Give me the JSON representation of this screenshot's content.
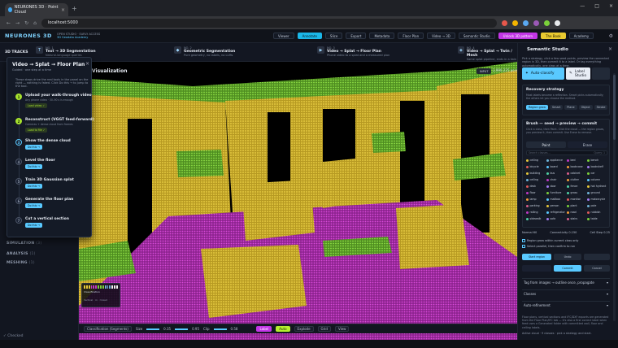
{
  "browser": {
    "tab_title": "NEURONES 3D · Point Cloud",
    "tab_close": "×",
    "new_tab": "+",
    "url": "localhost:5000",
    "window_controls": [
      "—",
      "□",
      "×"
    ],
    "nav": [
      "←",
      "→",
      "↻",
      "⌂"
    ]
  },
  "app": {
    "brand": "NEURONES 3D",
    "subtitle": [
      "OPEN STUDIO · EARLY ACCESS",
      "3D Geodata Academy"
    ],
    "toolbar": [
      {
        "label": "Viewer",
        "style": "plain"
      },
      {
        "label": "Annotate",
        "style": "active"
      },
      {
        "label": "Slice",
        "style": "plain"
      },
      {
        "label": "Export",
        "style": "plain"
      },
      {
        "label": "Metadata",
        "style": "plain"
      },
      {
        "label": "Floor Plan",
        "style": "plain"
      },
      {
        "label": "Video → 3D",
        "style": "plain"
      },
      {
        "label": "Semantic Studio",
        "style": "plain"
      },
      {
        "label": "Unlock 3D pattern",
        "style": "magenta"
      },
      {
        "label": "The Book",
        "style": "yellow"
      },
      {
        "label": "Academy",
        "style": "plain"
      }
    ]
  },
  "tracks": {
    "label": "3D TRACKS",
    "items": [
      {
        "tag": "NO. 1",
        "title": "Text → 3D Segmentation",
        "desc": "Natural-language queries"
      },
      {
        "tag": "NO. 2",
        "title": "Geometric Segmentation",
        "desc": "Pure geometry, no labels, no LLMs"
      },
      {
        "tag": "NO. 3",
        "title": "Video → Splat → Floor Plan",
        "desc": "Phone video to a splat and a measured plan"
      },
      {
        "tag": "NO. 4",
        "title": "Video → Splat → Twin / Mesh",
        "desc": "Same splat pipeline, ends in a twin"
      }
    ]
  },
  "sidebar": {
    "sections": [
      {
        "label": "SIMULATION",
        "count": "(3)"
      },
      {
        "label": "ANALYSIS",
        "count": "(1)"
      },
      {
        "label": "MESHING",
        "count": "(1)"
      }
    ],
    "footer": "✓ Checked"
  },
  "viewport": {
    "title": "Visualization",
    "input_chip": "INPUT",
    "point_count": "2,990,225 points",
    "legend_title": "Classification",
    "legend_sub": "Vertical · in · mixed",
    "colors": [
      "#e7c83a",
      "#c238c6",
      "#7bd23a",
      "#6fb4d8",
      "#f2f2f2"
    ]
  },
  "bottombar": {
    "mode": "Classification (Segments)",
    "size_label": "Size",
    "size_val": "0.35",
    "opacity_val": "0.95",
    "clip_label": "Clip",
    "clip_val": "0.58",
    "buttons": [
      "Label",
      "Auto",
      "Explode",
      "Grid",
      "View"
    ]
  },
  "popup": {
    "title": "Video → Splat → Floor Plan",
    "subtitle": "Guided · one step at a time",
    "intro": "These steps drive the real tools in the panel on the right — nothing is faked. Click Do this → to jump to the tool.",
    "steps": [
      {
        "n": "1",
        "state": "done",
        "title": "Upload your walk-through video",
        "desc": "Any phone video · 30–90 s is enough",
        "btn": "Load video ✓"
      },
      {
        "n": "2",
        "state": "done",
        "title": "Reconstruct (VGGT feed-forward)",
        "desc": "Cameras + dense cloud from frames",
        "btn": "Load to file ✓"
      },
      {
        "n": "3",
        "state": "cur",
        "title": "Show the dense cloud",
        "desc": "",
        "btn": "Do this →"
      },
      {
        "n": "4",
        "state": "todo",
        "title": "Level the floor",
        "desc": "",
        "btn": "Do this →"
      },
      {
        "n": "5",
        "state": "todo",
        "title": "Train 3D Gaussian splat",
        "desc": "",
        "btn": "Do this →"
      },
      {
        "n": "6",
        "state": "todo",
        "title": "Generate the floor plan",
        "desc": "",
        "btn": "Do this →"
      },
      {
        "n": "7",
        "state": "todo",
        "title": "Cut a vertical section",
        "desc": "",
        "btn": "Do this →"
      }
    ]
  },
  "rpanel": {
    "title": "Semantic Studio",
    "intro": "Pick a strategy, click a few seed points, preview the connected region in 3D, then commit it to a label. Or tag everything automatically, one class at a time.",
    "modes": [
      {
        "label": "Auto-classify",
        "on": true
      },
      {
        "label": "Label Studio",
        "on": false
      }
    ],
    "recovery": {
      "title": "Recovery strategy",
      "desc": "Most labels become a reflection. Smart picks automatically; the others let you choose the method.",
      "chips": [
        "Region grow",
        "Smart",
        "Plane",
        "Object",
        "Stroke"
      ]
    },
    "brush": {
      "title": "Brush — seed → preview → commit",
      "desc": "Click a class, then Paint. Click the cloud — the region grows, you preview it, then commit. Use Erase to remove.",
      "paint": "Paint",
      "erase": "Erase",
      "search_placeholder": "Search classes…",
      "query": "Query: 1"
    },
    "classes": [
      "ceiling",
      "appliance",
      "bed",
      "bench",
      "bicycle",
      "board",
      "bookcase",
      "bookshelf",
      "building",
      "bus",
      "cabinet",
      "car",
      "ceiling",
      "chair",
      "clutter",
      "column",
      "desk",
      "door",
      "fence",
      "hot hydrant",
      "floor",
      "furniture",
      "grass",
      "ground",
      "lamp",
      "mailbox",
      "monitor",
      "motorcycle",
      "parking",
      "person",
      "plant",
      "pole",
      "railing",
      "refrigerator",
      "road",
      "rubbish",
      "sidewalk",
      "sofa",
      "stairs",
      "table"
    ],
    "class_colors": [
      "#e7c83a",
      "#6fb4d8",
      "#c238c6",
      "#7bd23a",
      "#e05a5a",
      "#59c9ff",
      "#f29d38",
      "#a37cf0",
      "#e7c83a",
      "#4fd1a5",
      "#d95f8c",
      "#7bd23a",
      "#6fb4d8",
      "#c238c6",
      "#f29d38",
      "#59c9ff",
      "#e05a5a",
      "#a37cf0",
      "#4fd1a5",
      "#e7c83a",
      "#c238c6",
      "#7bd23a",
      "#4fd1a5",
      "#6fb4d8",
      "#f29d38",
      "#59c9ff",
      "#e05a5a",
      "#a37cf0",
      "#d95f8c",
      "#e7c83a",
      "#7bd23a",
      "#6fb4d8",
      "#c238c6",
      "#59c9ff",
      "#f29d38",
      "#e05a5a",
      "#4fd1a5",
      "#a37cf0",
      "#d95f8c",
      "#7bd23a"
    ],
    "params": [
      {
        "label": "Normal",
        "val": "60"
      },
      {
        "label": "Connectivity",
        "val": "0.150"
      },
      {
        "label": "Cell Step",
        "val": "0.25"
      }
    ],
    "checks": [
      "Region grow within current class only",
      "Select parallel, then confirm to run"
    ],
    "actions": [
      "Start region",
      "Undo",
      "Commit",
      "Cancel"
    ],
    "collapsibles": [
      "Tag from images → outline once, propagate",
      "Classes",
      "Auto-refinement"
    ],
    "footer": "Floor plans, vertical sections and IFC/DXF exports are generated from the Floor Plan/IFC tab — it's also a first correct label when feed uses a Generated folder with committed wall, floor and ceiling labels.",
    "status": "Active cloud · 9 classes · pick a strategy and start."
  }
}
